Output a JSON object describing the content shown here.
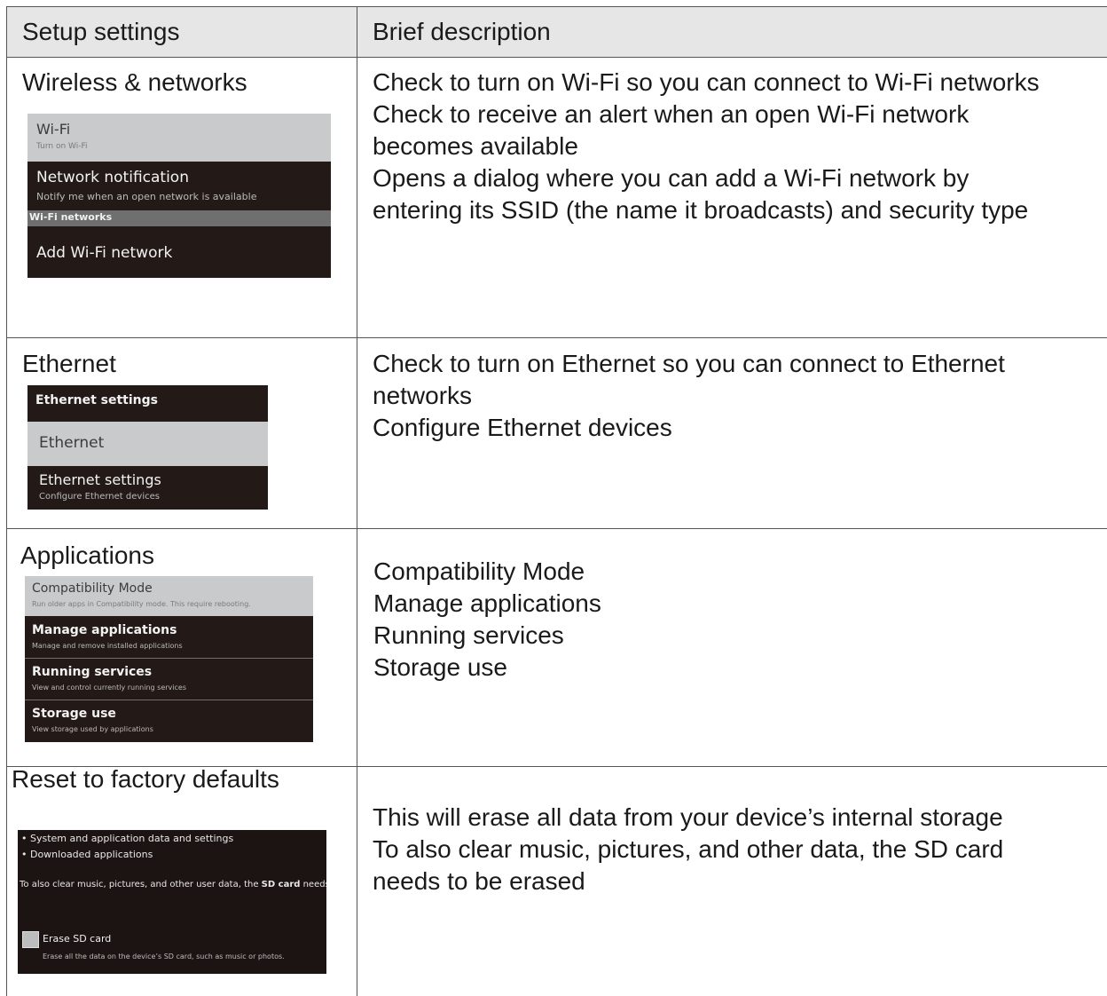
{
  "header": {
    "col1": "Setup settings",
    "col2": "Brief description"
  },
  "rows": {
    "wireless": {
      "title": "Wireless & networks",
      "desc": [
        "Check to turn on Wi-Fi so you can connect to Wi-Fi networks",
        "Check to receive an alert when an open Wi-Fi network",
        "becomes available",
        "Opens a dialog where you can add a Wi-Fi network by",
        "entering its SSID (the name it broadcasts) and security type"
      ],
      "shot": {
        "wifi_title": "Wi-Fi",
        "wifi_sub": "Turn on Wi-Fi",
        "notif_title": "Network notification",
        "notif_sub": "Notify me when an open network is available",
        "category": "Wi-Fi networks",
        "add_title": "Add Wi-Fi network"
      }
    },
    "ethernet": {
      "title": "Ethernet",
      "desc": [
        "Check to turn on Ethernet so you can connect to Ethernet",
        "networks",
        "Configure Ethernet devices"
      ],
      "shot": {
        "header": "Ethernet settings",
        "eth_title": "Ethernet",
        "settings_title": "Ethernet settings",
        "settings_sub": "Configure Ethernet devices"
      }
    },
    "applications": {
      "title": "Applications",
      "desc": [
        "Compatibility Mode",
        "Manage applications",
        "Running services",
        "Storage use"
      ],
      "shot": {
        "compat_title": "Compatibility Mode",
        "compat_sub": "Run older apps in Compatibility mode. This require rebooting.",
        "manage_title": "Manage applications",
        "manage_sub": "Manage and remove installed applications",
        "running_title": "Running services",
        "running_sub": "View and control currently running services",
        "storage_title": "Storage use",
        "storage_sub": "View storage used by applications"
      }
    },
    "reset": {
      "title": "Reset to factory defaults",
      "desc": [
        "This will erase all data from your device’s internal storage",
        "To also clear music, pictures, and other data, the SD card",
        "needs to be erased"
      ],
      "shot": {
        "bullet1": "• System and application data and settings",
        "bullet2": "• Downloaded applications",
        "note_pre": "To also clear music, pictures, and other user data, the ",
        "note_bold": "SD card",
        "note_post": " needs to",
        "erase_title": "Erase SD card",
        "erase_sub": "Erase all the data on the device’s SD card, such as music or photos."
      }
    }
  }
}
